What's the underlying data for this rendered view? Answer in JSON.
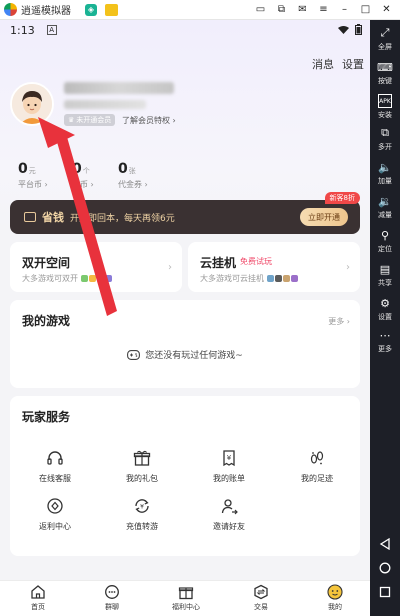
{
  "window": {
    "app_name": "逍遥模拟器"
  },
  "status_bar": {
    "time": "1:13"
  },
  "header": {
    "messages_label": "消息",
    "settings_label": "设置"
  },
  "profile": {
    "member_badge": "未开通会员",
    "member_link": "了解会员特权 ›"
  },
  "stats": [
    {
      "value": "0",
      "unit": "元",
      "label": "平台币 ›"
    },
    {
      "value": "0",
      "unit": "个",
      "label": "金币 ›"
    },
    {
      "value": "0",
      "unit": "张",
      "label": "代金券 ›"
    }
  ],
  "vip_banner": {
    "title": "省钱",
    "desc": "开通即回本，每天再领6元",
    "button": "立即开通",
    "tag": "新客8折"
  },
  "cards": {
    "dual": {
      "title": "双开空间",
      "subtitle": "大多游戏可双开"
    },
    "cloud": {
      "title": "云挂机",
      "tag": "免费试玩",
      "subtitle": "大多游戏可云挂机"
    }
  },
  "my_games": {
    "title": "我的游戏",
    "more": "更多 ›",
    "empty_text": "您还没有玩过任何游戏~"
  },
  "services": {
    "title": "玩家服务",
    "items": [
      {
        "label": "在线客服",
        "icon": "headset-icon"
      },
      {
        "label": "我的礼包",
        "icon": "gift-icon"
      },
      {
        "label": "我的账单",
        "icon": "bill-icon"
      },
      {
        "label": "我的足迹",
        "icon": "footprint-icon"
      },
      {
        "label": "返利中心",
        "icon": "rebate-icon"
      },
      {
        "label": "充值转游",
        "icon": "transfer-icon"
      },
      {
        "label": "邀请好友",
        "icon": "invite-icon"
      }
    ]
  },
  "bottom_nav": [
    {
      "label": "首页",
      "icon": "home-icon"
    },
    {
      "label": "群聊",
      "icon": "chat-icon"
    },
    {
      "label": "福利中心",
      "icon": "welfare-icon"
    },
    {
      "label": "交易",
      "icon": "trade-icon"
    },
    {
      "label": "我的",
      "icon": "me-icon"
    }
  ],
  "emulator_sidebar": [
    {
      "label": "全屏",
      "icon": "fullscreen-icon"
    },
    {
      "label": "按键",
      "icon": "keyboard-icon"
    },
    {
      "label": "安装",
      "icon": "apk-icon"
    },
    {
      "label": "多开",
      "icon": "multi-icon"
    },
    {
      "label": "加量",
      "icon": "volume-up-icon"
    },
    {
      "label": "减量",
      "icon": "volume-down-icon"
    },
    {
      "label": "定位",
      "icon": "location-icon"
    },
    {
      "label": "共享",
      "icon": "share-icon"
    },
    {
      "label": "设置",
      "icon": "gear-icon"
    },
    {
      "label": "更多",
      "icon": "more-icon"
    }
  ],
  "colors": {
    "accent_red": "#e8323c",
    "vip_bg": "#3a3132",
    "vip_gold": "#f1d5a6",
    "sidebar_bg": "#1d1f27"
  }
}
